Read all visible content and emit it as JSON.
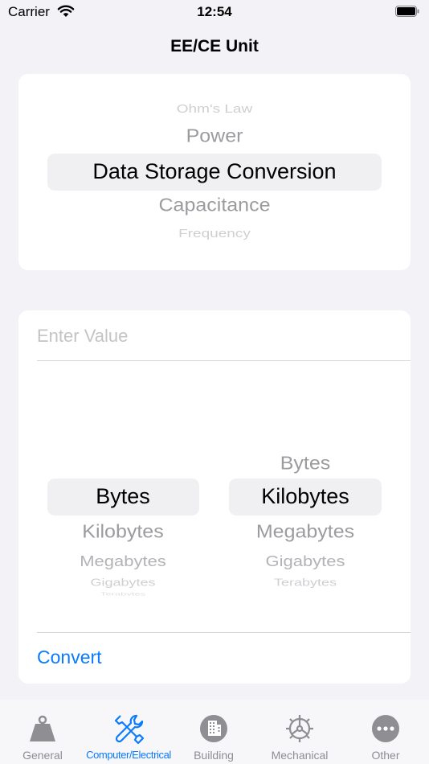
{
  "status_bar": {
    "carrier": "Carrier",
    "time": "12:54"
  },
  "nav": {
    "title": "EE/CE Unit"
  },
  "category_picker": {
    "items": [
      "Ohm's Law",
      "Power",
      "Data Storage Conversion",
      "Capacitance",
      "Frequency"
    ],
    "selected": "Data Storage Conversion"
  },
  "converter": {
    "input_placeholder": "Enter Value",
    "input_value": "",
    "from_picker": {
      "items": [
        "Bytes",
        "Kilobytes",
        "Megabytes",
        "Gigabytes",
        "Terabytes"
      ],
      "selected": "Bytes"
    },
    "to_picker": {
      "items": [
        "Bytes",
        "Kilobytes",
        "Megabytes",
        "Gigabytes",
        "Terabytes"
      ],
      "selected": "Kilobytes"
    },
    "convert_label": "Convert"
  },
  "tab_bar": {
    "tabs": [
      {
        "label": "General",
        "icon": "weight-icon"
      },
      {
        "label": "Computer/Electrical",
        "icon": "tools-icon"
      },
      {
        "label": "Building",
        "icon": "building-icon"
      },
      {
        "label": "Mechanical",
        "icon": "gear-icon"
      },
      {
        "label": "Other",
        "icon": "ellipsis-icon"
      }
    ],
    "active": "Computer/Electrical"
  },
  "colors": {
    "accent": "#0a7aff",
    "inactive": "#8e8e93",
    "background": "#f2f2f7"
  }
}
